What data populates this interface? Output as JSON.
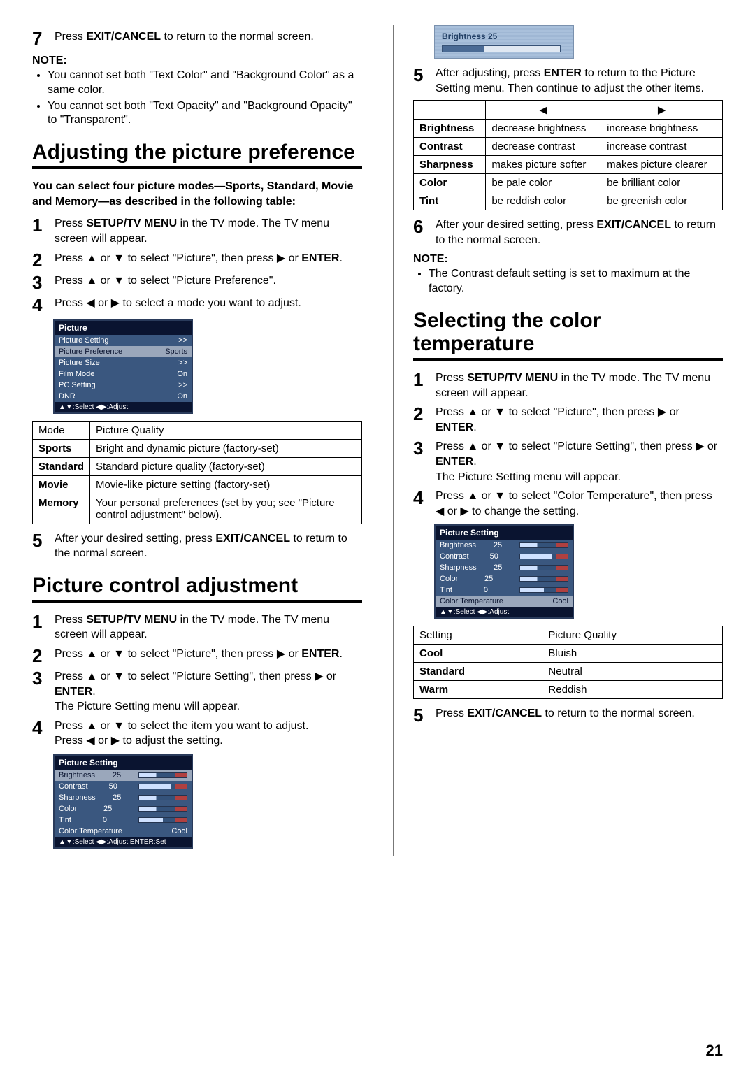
{
  "left": {
    "step7": {
      "num": "7",
      "prefix": "Press ",
      "bold": "EXIT/CANCEL",
      "suffix": " to return to the normal screen."
    },
    "note": {
      "head": "NOTE:",
      "items": [
        "You cannot set both \"Text Color\" and \"Background Color\" as a same color.",
        "You cannot set both \"Text Opacity\" and \"Background Opacity\" to \"Transparent\"."
      ]
    },
    "sectionA": {
      "title": "Adjusting the picture preference",
      "intro": "You can select four picture modes—Sports, Standard, Movie and Memory—as described in the following table:",
      "steps": [
        {
          "num": "1",
          "parts": [
            "Press ",
            "SETUP/TV MENU",
            " in the TV mode. The TV menu screen will appear."
          ]
        },
        {
          "num": "2",
          "parts": [
            "Press ▲ or ▼ to select \"Picture\", then press ▶ or ",
            "ENTER",
            "."
          ]
        },
        {
          "num": "3",
          "parts": [
            "Press ▲ or ▼ to select \"Picture Preference\"."
          ]
        },
        {
          "num": "4",
          "parts": [
            "Press ◀ or ▶ to select a mode you want to adjust."
          ]
        }
      ],
      "osd": {
        "title": "Picture",
        "rows": [
          [
            "Picture Setting",
            ">>"
          ],
          [
            "Picture Preference",
            "Sports"
          ],
          [
            "Picture Size",
            ">>"
          ],
          [
            "Film Mode",
            "On"
          ],
          [
            "PC Setting",
            ">>"
          ],
          [
            "DNR",
            "On"
          ]
        ],
        "selectedIndex": 1,
        "foot": "▲▼:Select   ◀▶:Adjust"
      },
      "modeTable": {
        "head": [
          "Mode",
          "Picture Quality"
        ],
        "rows": [
          [
            "Sports",
            "Bright and dynamic picture (factory-set)"
          ],
          [
            "Standard",
            "Standard picture quality (factory-set)"
          ],
          [
            "Movie",
            "Movie-like picture setting (factory-set)"
          ],
          [
            "Memory",
            "Your personal preferences (set by you; see \"Picture control adjustment\" below)."
          ]
        ]
      },
      "step5": {
        "num": "5",
        "parts": [
          "After your desired setting, press ",
          "EXIT/CANCEL",
          " to return to the normal screen."
        ]
      }
    },
    "sectionB": {
      "title": "Picture control adjustment",
      "steps": [
        {
          "num": "1",
          "parts": [
            "Press ",
            "SETUP/TV MENU",
            " in the TV mode. The TV menu screen will appear."
          ]
        },
        {
          "num": "2",
          "parts": [
            "Press ▲ or ▼ to select \"Picture\", then press ▶ or ",
            "ENTER",
            "."
          ]
        },
        {
          "num": "3",
          "parts": [
            "Press ▲ or ▼ to select \"Picture Setting\", then press ▶ or ",
            "ENTER",
            ".",
            "\nThe Picture Setting menu will appear."
          ]
        },
        {
          "num": "4",
          "parts": [
            "Press ▲ or ▼ to select the item you want to adjust.",
            "\nPress ◀ or ▶ to adjust the setting."
          ]
        }
      ],
      "osd": {
        "title": "Picture Setting",
        "rows": [
          [
            "Brightness",
            "25",
            36
          ],
          [
            "Contrast",
            "50",
            67
          ],
          [
            "Sharpness",
            "25",
            36
          ],
          [
            "Color",
            "25",
            36
          ],
          [
            "Tint",
            "0",
            50
          ],
          [
            "Color Temperature",
            "Cool",
            null
          ]
        ],
        "selectedIndex": 0,
        "foot": "▲▼:Select   ◀▶:Adjust   ENTER:Set"
      }
    }
  },
  "right": {
    "brightBox": "Brightness 25",
    "step5": {
      "num": "5",
      "parts": [
        "After adjusting, press ",
        "ENTER",
        " to return to the Picture Setting menu. Then continue to adjust the other items."
      ]
    },
    "adjustTable": {
      "head": [
        "",
        "◀",
        "▶"
      ],
      "rows": [
        [
          "Brightness",
          "decrease brightness",
          "increase brightness"
        ],
        [
          "Contrast",
          "decrease contrast",
          "increase contrast"
        ],
        [
          "Sharpness",
          "makes picture softer",
          "makes picture clearer"
        ],
        [
          "Color",
          "be pale color",
          "be brilliant color"
        ],
        [
          "Tint",
          "be reddish color",
          "be greenish color"
        ]
      ]
    },
    "step6": {
      "num": "6",
      "parts": [
        "After your desired setting, press ",
        "EXIT/CANCEL",
        " to return to the normal screen."
      ]
    },
    "note": {
      "head": "NOTE:",
      "items": [
        "The Contrast default setting is set to maximum at the factory."
      ]
    },
    "sectionC": {
      "title": "Selecting the color temperature",
      "steps": [
        {
          "num": "1",
          "parts": [
            "Press ",
            "SETUP/TV MENU",
            " in the TV mode. The TV menu screen will appear."
          ]
        },
        {
          "num": "2",
          "parts": [
            "Press ▲ or ▼ to select \"Picture\", then press ▶ or ",
            "ENTER",
            "."
          ]
        },
        {
          "num": "3",
          "parts": [
            "Press ▲ or ▼ to select \"Picture Setting\", then press ▶ or ",
            "ENTER",
            ".",
            "\nThe Picture Setting menu will appear."
          ]
        },
        {
          "num": "4",
          "parts": [
            "Press ▲ or ▼ to select \"Color Temperature\", then press ◀ or ▶ to change the setting."
          ]
        }
      ],
      "osd": {
        "title": "Picture Setting",
        "rows": [
          [
            "Brightness",
            "25",
            36
          ],
          [
            "Contrast",
            "50",
            67
          ],
          [
            "Sharpness",
            "25",
            36
          ],
          [
            "Color",
            "25",
            36
          ],
          [
            "Tint",
            "0",
            50
          ],
          [
            "Color Temperature",
            "Cool",
            null
          ]
        ],
        "selectedIndex": 5,
        "foot": "▲▼:Select   ◀▶:Adjust"
      },
      "tempTable": {
        "head": [
          "Setting",
          "Picture Quality"
        ],
        "rows": [
          [
            "Cool",
            "Bluish"
          ],
          [
            "Standard",
            "Neutral"
          ],
          [
            "Warm",
            "Reddish"
          ]
        ]
      },
      "step5": {
        "num": "5",
        "parts": [
          "Press ",
          "EXIT/CANCEL",
          " to return to the normal screen."
        ]
      }
    }
  },
  "pageNum": "21"
}
